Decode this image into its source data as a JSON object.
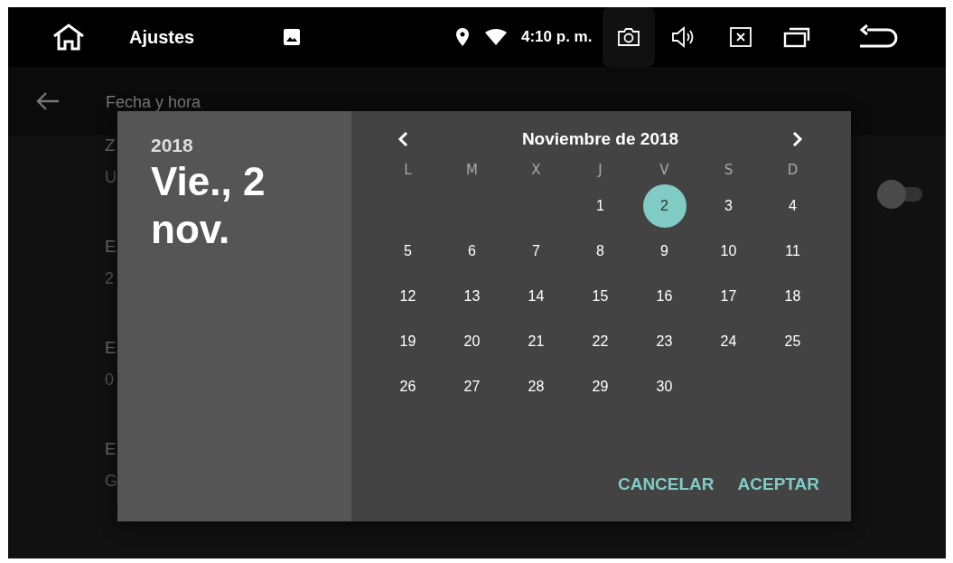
{
  "status_bar": {
    "title": "Ajustes",
    "time": "4:10 p. m."
  },
  "app_bar": {
    "title": "Fecha y hora"
  },
  "background_items": [
    {
      "title": "Z",
      "subtitle": "U"
    },
    {
      "title": "E",
      "subtitle": "2"
    },
    {
      "title": "E",
      "subtitle": "0"
    },
    {
      "title": "E",
      "subtitle": "G"
    }
  ],
  "toggle": {
    "on": false
  },
  "dialog": {
    "year": "2018",
    "date": "Vie., 2 nov.",
    "month": "Noviembre de 2018",
    "weekdays": [
      "L",
      "M",
      "X",
      "J",
      "V",
      "S",
      "D"
    ],
    "weeks": [
      [
        {
          "label": "1",
          "selected": false
        },
        {
          "label": "2",
          "selected": true
        },
        {
          "label": "3",
          "selected": false
        },
        {
          "label": "4",
          "selected": false
        }
      ],
      [
        {
          "label": "5",
          "selected": false
        },
        {
          "label": "6",
          "selected": false
        },
        {
          "label": "7",
          "selected": false
        },
        {
          "label": "8",
          "selected": false
        },
        {
          "label": "9",
          "selected": false
        },
        {
          "label": "10",
          "selected": false
        },
        {
          "label": "11",
          "selected": false
        }
      ],
      [
        {
          "label": "12",
          "selected": false
        },
        {
          "label": "13",
          "selected": false
        },
        {
          "label": "14",
          "selected": false
        },
        {
          "label": "15",
          "selected": false
        },
        {
          "label": "16",
          "selected": false
        },
        {
          "label": "17",
          "selected": false
        },
        {
          "label": "18",
          "selected": false
        }
      ],
      [
        {
          "label": "19",
          "selected": false
        },
        {
          "label": "20",
          "selected": false
        },
        {
          "label": "21",
          "selected": false
        },
        {
          "label": "22",
          "selected": false
        },
        {
          "label": "23",
          "selected": false
        },
        {
          "label": "24",
          "selected": false
        },
        {
          "label": "25",
          "selected": false
        }
      ],
      [
        {
          "label": "26",
          "selected": false
        },
        {
          "label": "27",
          "selected": false
        },
        {
          "label": "28",
          "selected": false
        },
        {
          "label": "29",
          "selected": false
        },
        {
          "label": "30",
          "selected": false
        }
      ]
    ],
    "buttons": [
      "CANCELAR",
      "ACEPTAR"
    ]
  }
}
